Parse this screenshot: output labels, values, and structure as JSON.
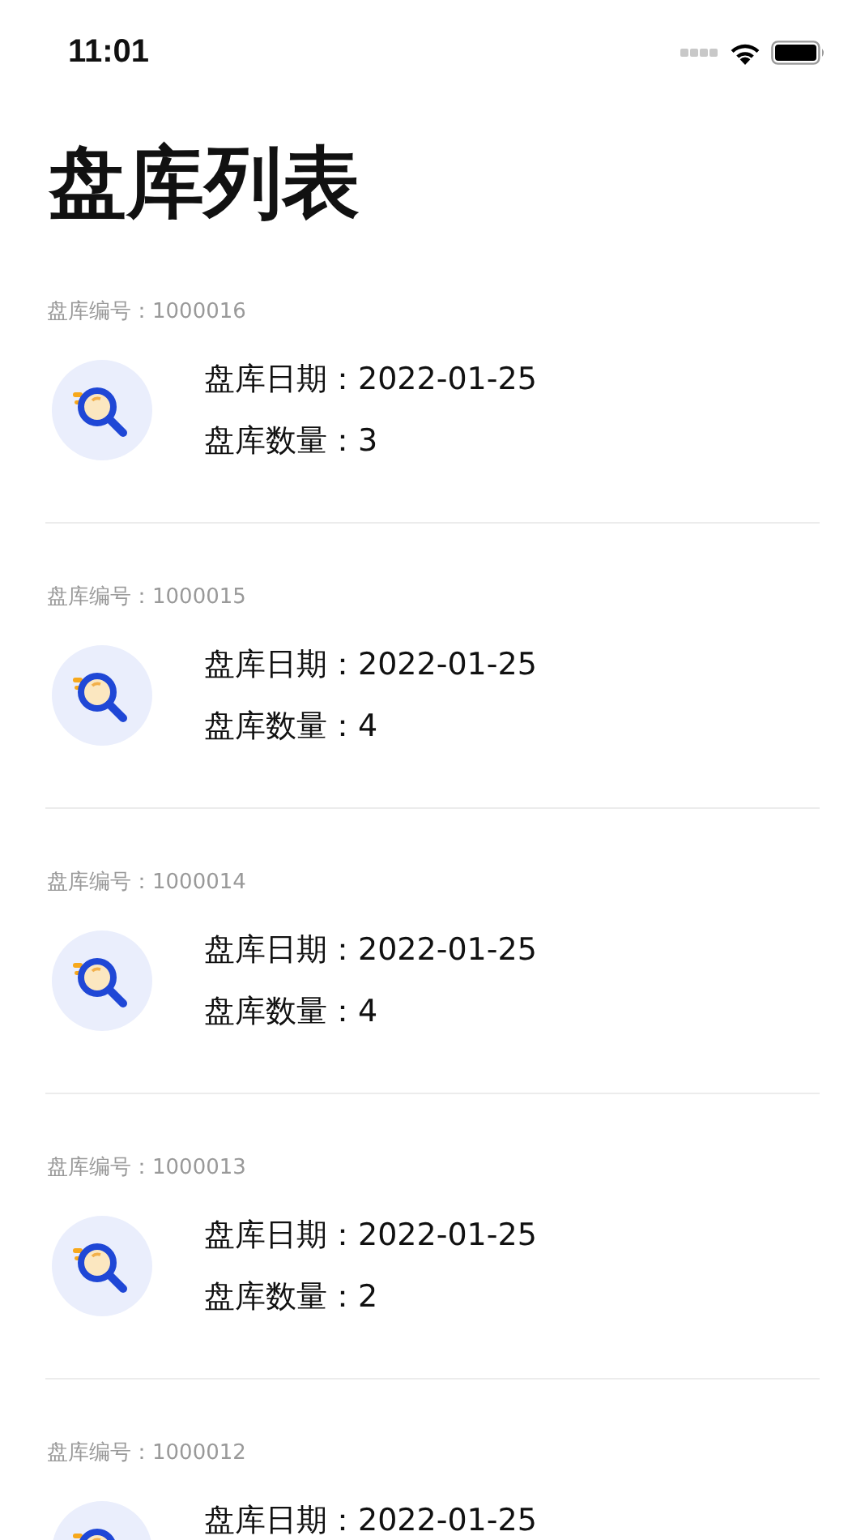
{
  "status_bar": {
    "time": "11:01"
  },
  "title": "盘库列表",
  "records": [
    {
      "number_label": "盘库编号：1000016",
      "date": "盘库日期：2022-01-25",
      "quantity": "盘库数量：3"
    },
    {
      "number_label": "盘库编号：1000015",
      "date": "盘库日期：2022-01-25",
      "quantity": "盘库数量：4"
    },
    {
      "number_label": "盘库编号：1000014",
      "date": "盘库日期：2022-01-25",
      "quantity": "盘库数量：4"
    },
    {
      "number_label": "盘库编号：1000013",
      "date": "盘库日期：2022-01-25",
      "quantity": "盘库数量：2"
    },
    {
      "number_label": "盘库编号：1000012",
      "date": "盘库日期：2022-01-25"
    }
  ]
}
